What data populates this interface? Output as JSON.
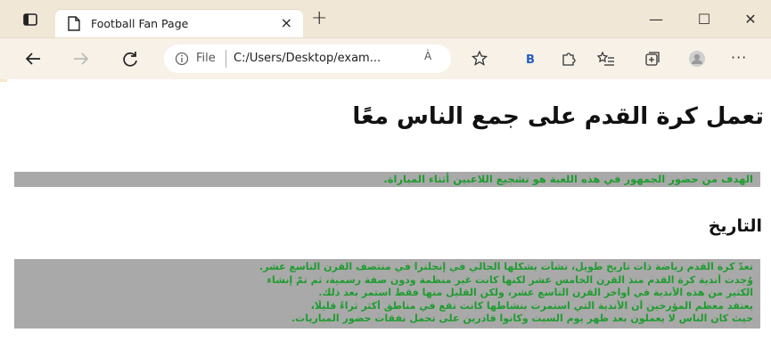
{
  "browser": {
    "tab_title": "Football Fan Page",
    "tab_close": "×",
    "new_tab": "+",
    "url_file_label": "File",
    "url": "C:/Users/Desktop/exam...",
    "read_aloud": "À",
    "window_controls": {
      "minimize": "—",
      "maximize": "☐",
      "close": "✕"
    },
    "menu": "···",
    "icons": [
      "tab-actions-icon",
      "back-icon",
      "forward-icon",
      "refresh-icon",
      "info-icon",
      "favorite-icon",
      "bing-icon",
      "extensions-icon",
      "favorites-list-icon",
      "collections-icon",
      "profile-icon"
    ]
  },
  "page": {
    "heading": "تعمل كرة القدم على جمع الناس معًا",
    "intro": "الهدف من حضور الجمهور في هذه اللعبة هو تشجيع اللاعبين أثناء المباراة.",
    "section_title": "التاريخ",
    "history_lines": [
      "تعدّ كرة القدم رياضة ذات تاريخ طويل، نشأت بشكلها الحالي في إنجلترا في منتصف القرن التاسع عشر.",
      "وُجدت أندية كرة القدم منذ القرن الخامس عشر لكنها كانت غير منظمة ودون صفة رسمية، ثم تمّ إنشاء",
      "الكثير من هذه الأندية في أواخر القرن التاسع عشر، ولكن القليل منها فقط استمر بعد ذلك.",
      "يعتقد معظم المؤرخين أن الأندية التي استمرت بنشاطها كانت تقع في مناطق أكثر ثراءً قليلًا،",
      "حيث كان الناس لا يعملون بعد ظهر يوم السبت وكانوا قادرين على تحمل نفقات حضور المباريات."
    ]
  },
  "colors": {
    "paragraph_bg": "#a9a9a9",
    "paragraph_text": "#1e9c2f",
    "chrome_bg": "#f1e7d6"
  }
}
